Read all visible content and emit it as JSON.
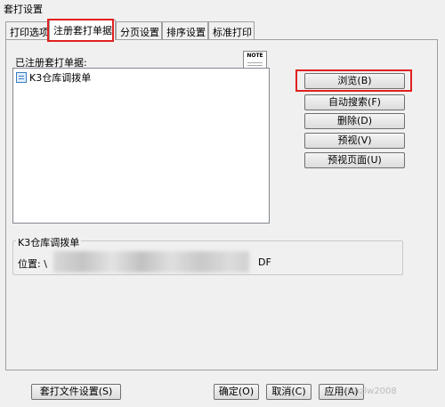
{
  "window": {
    "title": "套打设置"
  },
  "tabs": [
    {
      "label": "打印选项"
    },
    {
      "label": "注册套打单据"
    },
    {
      "label": "分页设置"
    },
    {
      "label": "排序设置"
    },
    {
      "label": "标准打印"
    }
  ],
  "registered": {
    "label": "已注册套打单据:",
    "note_icon_text": "NOTE",
    "items": [
      {
        "label": "K3仓库调拨单"
      }
    ]
  },
  "actions": {
    "browse": "浏览(B)",
    "auto_search": "自动搜索(F)",
    "delete": "删除(D)",
    "preview": "预视(V)",
    "preview_page": "预视页面(U)"
  },
  "detail": {
    "group_title": "K3仓库调拨单",
    "position_label": "位置:",
    "position_prefix": "\\",
    "position_suffix": "DF"
  },
  "footer": {
    "template_settings": "套打文件设置(S)",
    "ok": "确定(O)",
    "cancel": "取消(C)",
    "apply": "应用(A)"
  },
  "watermark": "net/nzlw2008"
}
